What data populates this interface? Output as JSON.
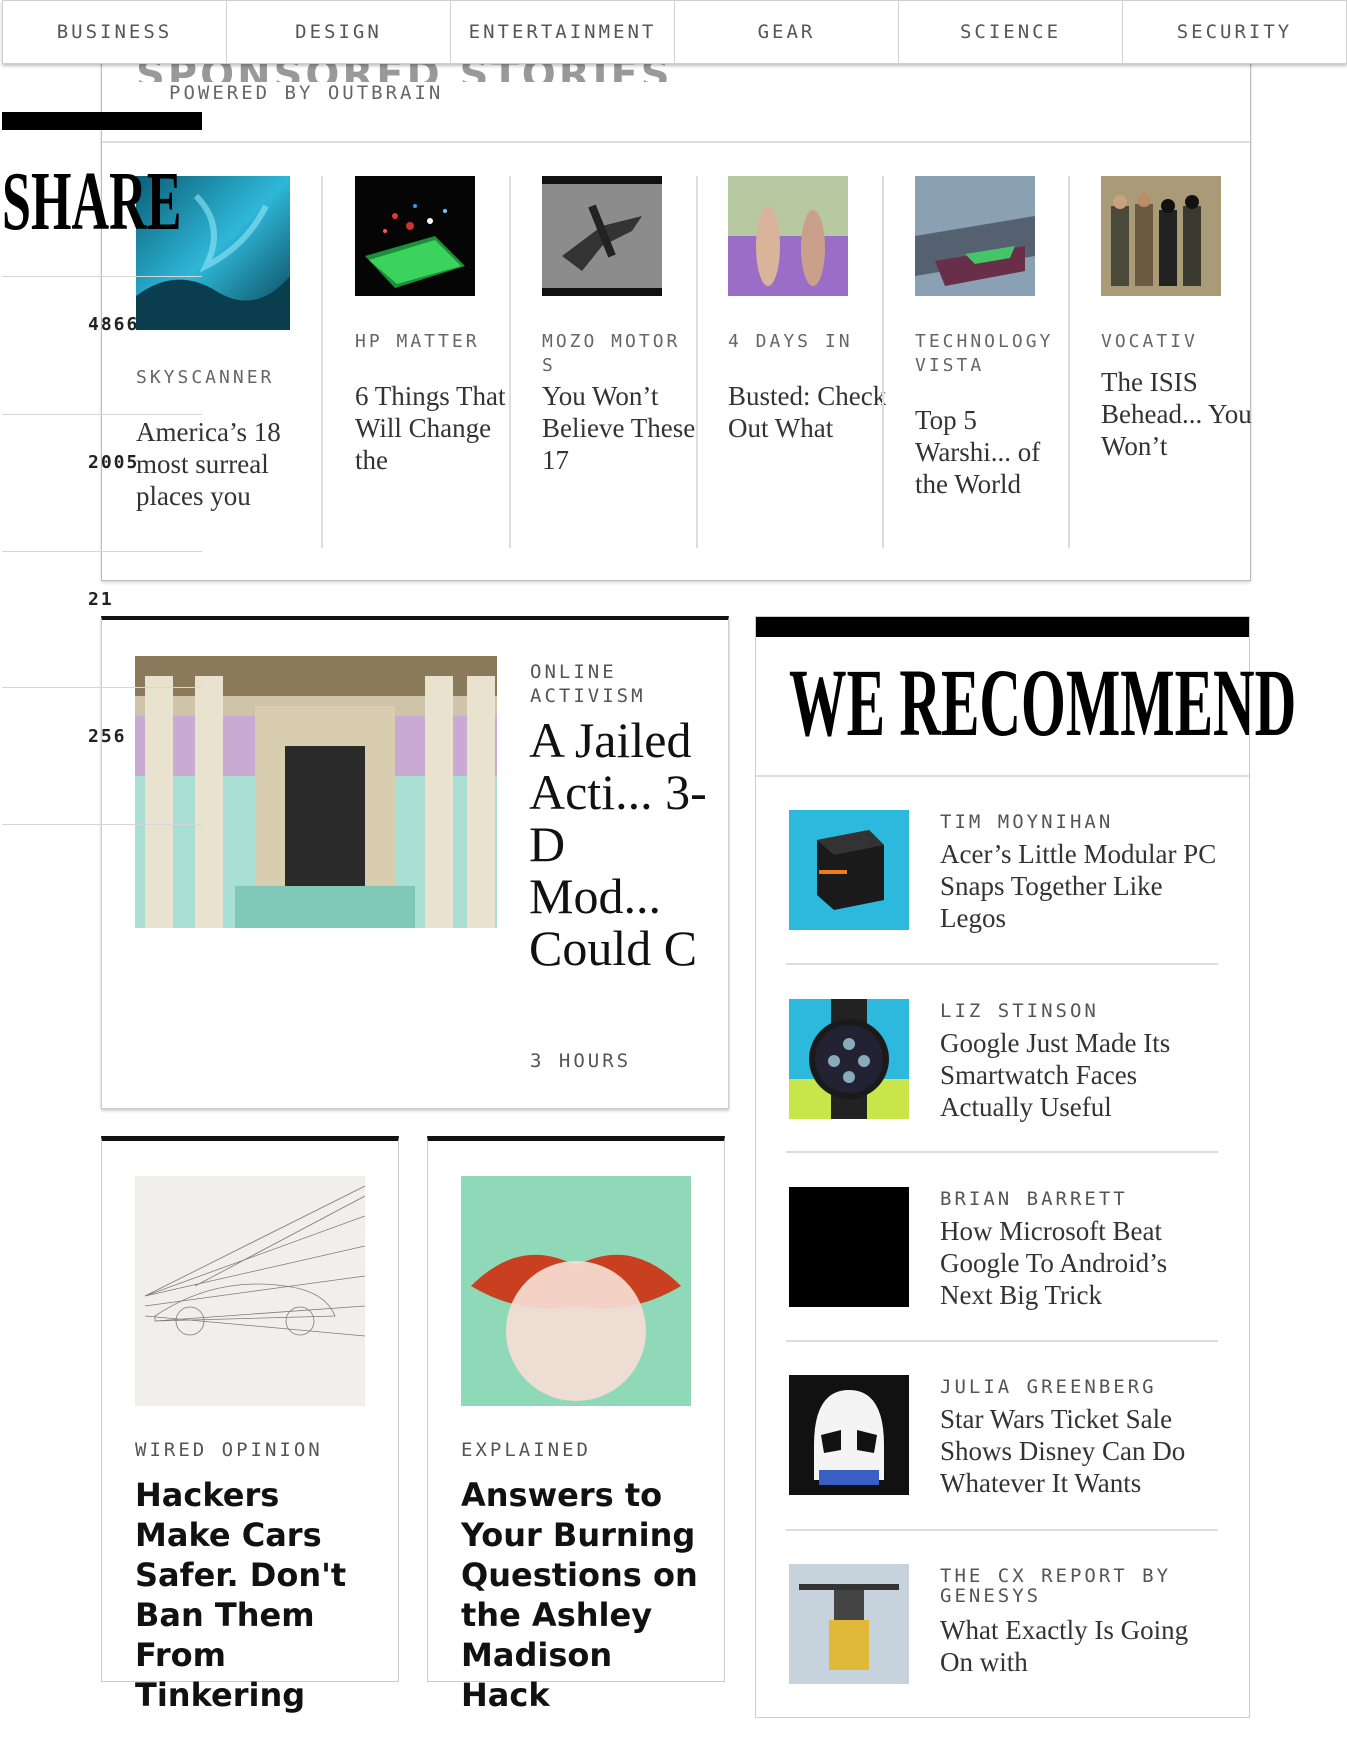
{
  "nav": {
    "items": [
      "BUSINESS",
      "DESIGN",
      "ENTERTAINMENT",
      "GEAR",
      "SCIENCE",
      "SECURITY"
    ]
  },
  "outbrain": {
    "section_title": "SPONSORED STORIES",
    "powered_by": "POWERED BY OUTBRAIN",
    "stories": [
      {
        "source": "SKYSCANNER",
        "title": "America’s 18 most surreal places you"
      },
      {
        "source": "HP MATTER",
        "title": "6 Things That Will Change the"
      },
      {
        "source": "MOZO MOTORS",
        "title": "You Won’t Believe These 17"
      },
      {
        "source": "4 DAYS IN",
        "title": "Busted: Check Out What"
      },
      {
        "source": "TECHNOLOGY VISTA",
        "title": "Top 5 Warshi... of the World"
      },
      {
        "source": "VOCATIV",
        "title": "The ISIS Behead... You Won’t"
      }
    ]
  },
  "share": {
    "title": "SHARE",
    "counts": [
      "4866",
      "2005",
      "21",
      "256"
    ]
  },
  "featured": {
    "category": "ONLINE ACTIVISM",
    "title": "A Jailed Acti... 3-D Mod... Could C",
    "time": "3 HOURS"
  },
  "cards": [
    {
      "category": "WIRED OPINION",
      "title": "Hackers Make Cars Safer. Don't Ban Them From Tinkering"
    },
    {
      "category": "EXPLAINED",
      "title": "Answers to Your Burning Questions on the Ashley Madison Hack"
    }
  ],
  "recommend": {
    "title": "WE RECOMMEND",
    "items": [
      {
        "author": "TIM MOYNIHAN",
        "title": "Acer’s Little Modular PC Snaps Together Like Legos"
      },
      {
        "author": "LIZ STINSON",
        "title": "Google Just Made Its Smartwatch Faces Actually Useful"
      },
      {
        "author": "BRIAN BARRETT",
        "title": "How Microsoft Beat Google To Android’s Next Big Trick"
      },
      {
        "author": "JULIA GREENBERG",
        "title": "Star Wars Ticket Sale Shows Disney Can Do Whatever It Wants"
      },
      {
        "author": "THE CX REPORT BY GENESYS",
        "title": "What Exactly Is Going On with"
      }
    ]
  }
}
